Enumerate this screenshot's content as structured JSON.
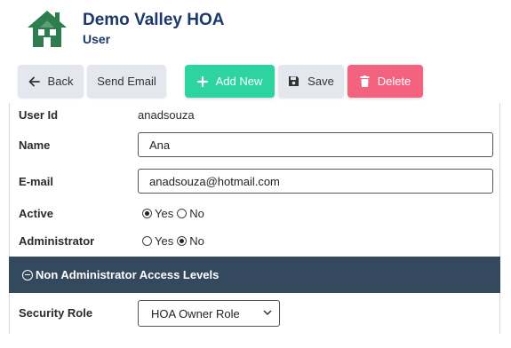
{
  "header": {
    "org_name": "Demo Valley HOA",
    "page_name": "User",
    "logo_icon": "house-logo-icon",
    "brand_color": "#1a3a6b",
    "logo_color": "#2e7d4f"
  },
  "toolbar": {
    "back_label": "Back",
    "send_email_label": "Send Email",
    "add_new_label": "Add New",
    "save_label": "Save",
    "delete_label": "Delete",
    "add_color": "#2dd4a0",
    "delete_color": "#f36380"
  },
  "form": {
    "user_id_label": "User Id",
    "user_id_value": "anadsouza",
    "name_label": "Name",
    "name_value": "Ana",
    "email_label": "E-mail",
    "email_value": "anadsouza@hotmail.com",
    "active_label": "Active",
    "active_yes": "Yes",
    "active_no": "No",
    "active_selected": "Yes",
    "admin_label": "Administrator",
    "admin_yes": "Yes",
    "admin_no": "No",
    "admin_selected": "No"
  },
  "access_section": {
    "title": "Non Administrator Access Levels",
    "bar_color": "#34495e",
    "security_role_label": "Security Role",
    "security_role_value": "HOA Owner Role"
  }
}
